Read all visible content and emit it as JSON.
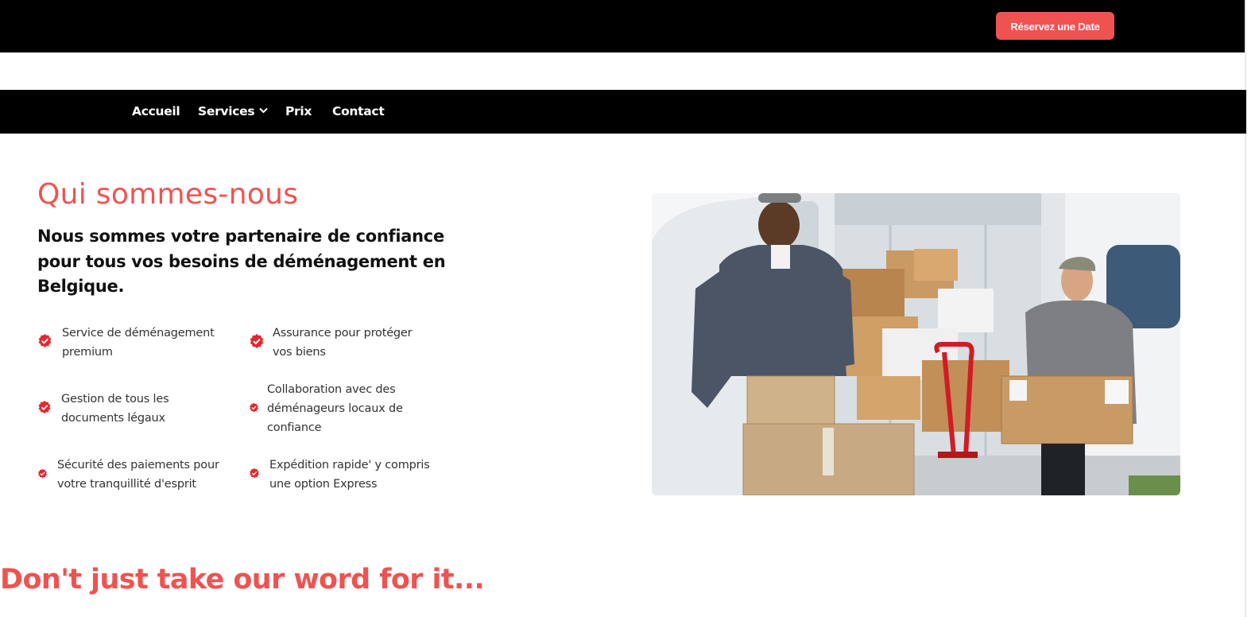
{
  "header": {
    "cta_label": "Réservez une Date"
  },
  "nav": {
    "items": [
      {
        "label": "Accueil"
      },
      {
        "label": "Services",
        "has_dropdown": true
      },
      {
        "label": "Prix"
      },
      {
        "label": "Contact"
      }
    ]
  },
  "about": {
    "title": "Qui sommes-nous",
    "subtitle": "Nous sommes votre partenaire de confiance pour tous vos besoins de déménagement en Belgique.",
    "features": [
      {
        "line1": "Service de déménagement",
        "line2": "premium"
      },
      {
        "line1": "Assurance pour protéger",
        "line2": "vos biens"
      },
      {
        "line1": "Gestion de tous les",
        "line2": "documents légaux"
      },
      {
        "line1": "Collaboration avec des",
        "line2": "déménageurs locaux de",
        "line3": "confiance"
      },
      {
        "line1": "Sécurité des paiements pour",
        "line2": "votre tranquillité d'esprit"
      },
      {
        "line1": "Expédition rapide' y compris",
        "line2": "une option Express"
      }
    ],
    "check_icon": "badge-check-icon",
    "image_alt": "movers-with-boxes-photo"
  },
  "testimonials": {
    "title": "Don't just take our word for it..."
  },
  "colors": {
    "accent": "#ef5350",
    "check_red": "#e8262c",
    "bar_black": "#000000"
  }
}
